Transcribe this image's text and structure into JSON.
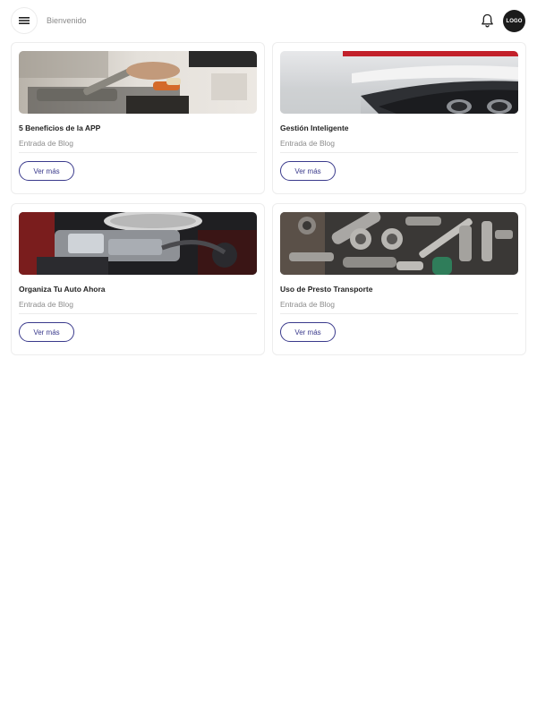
{
  "header": {
    "welcome": "Bienvenido",
    "logo_text": "LOGO",
    "menu_icon": "hamburger-menu-icon",
    "bell_icon": "bell-icon"
  },
  "cards": [
    {
      "title": "5 Beneficios de la APP",
      "subtitle": "Entrada de Blog",
      "button": "Ver más",
      "image": "tools-on-workbench-photo"
    },
    {
      "title": "Gestión Inteligente",
      "subtitle": "Entrada de Blog",
      "button": "Ver más",
      "image": "white-car-rear-bumper-photo"
    },
    {
      "title": "Organiza Tu Auto Ahora",
      "subtitle": "Entrada de Blog",
      "button": "Ver más",
      "image": "car-engine-photo"
    },
    {
      "title": "Uso de Presto Transporte",
      "subtitle": "Entrada de Blog",
      "button": "Ver más",
      "image": "socket-wrench-set-photo"
    }
  ],
  "colors": {
    "accent": "#3a3a8c",
    "logo_bg": "#1b1b1b",
    "muted_text": "#8c8c8c",
    "border": "#ededed"
  }
}
